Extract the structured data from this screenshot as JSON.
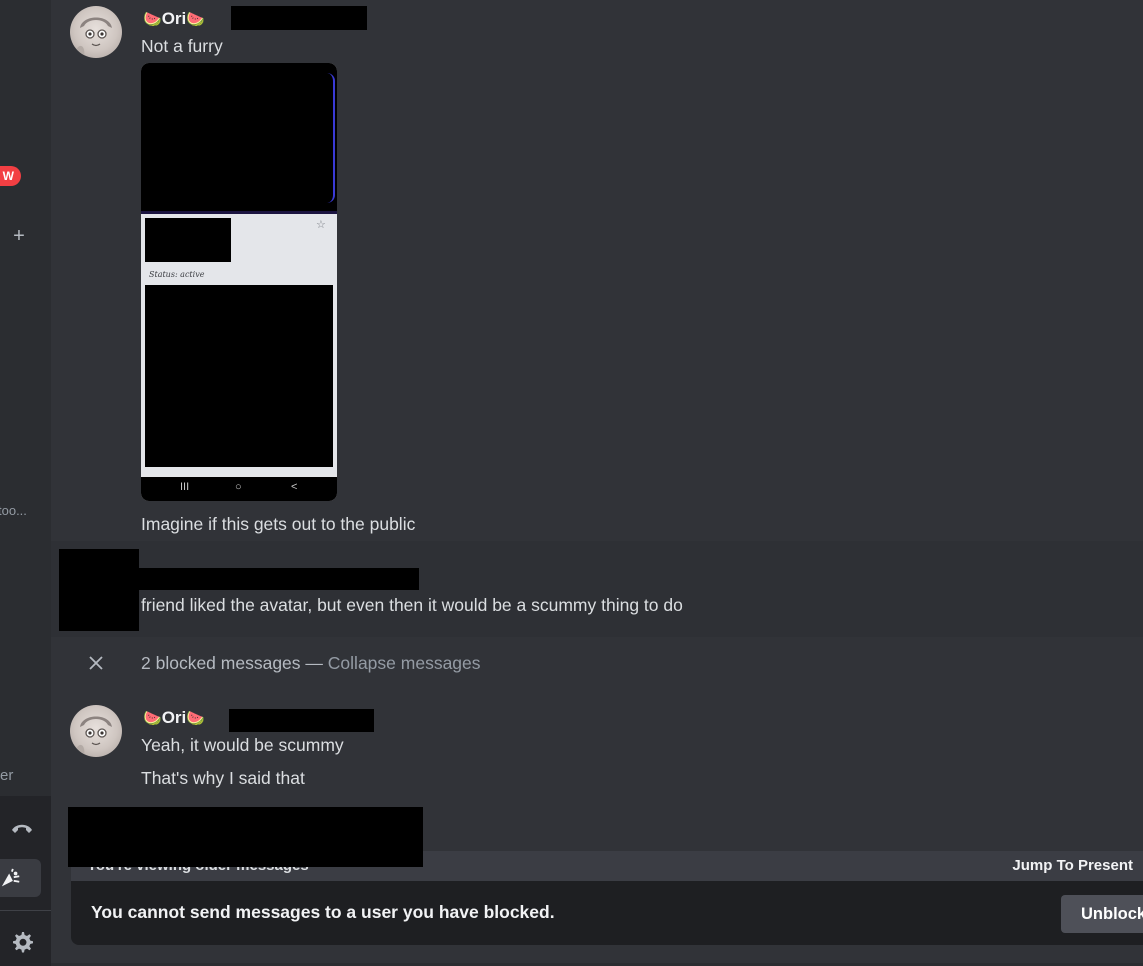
{
  "sidebar": {
    "badge_text": "W",
    "add_glyph": "+",
    "truncated_name": "too...",
    "truncated_label": "er",
    "icons": [
      "phone-hangup-icon",
      "soundboard-icon",
      "gear-icon"
    ]
  },
  "messages": [
    {
      "author_name": "Ori",
      "author_emoji": "🍉",
      "lines": [
        "Not a furry"
      ],
      "attachment": {
        "status_text": "Status: active",
        "star_glyph": "☆",
        "nav_buttons": [
          "III",
          "○",
          "<"
        ]
      },
      "after_text": "Imagine if this gets out to the public"
    },
    {
      "author_name": "",
      "lines": [
        "friend liked the avatar, but even then it would be a scummy thing to do"
      ]
    },
    {
      "author_name": "Ori",
      "author_emoji": "🍉",
      "lines": [
        "Yeah, it would be scummy",
        "That's why I said that"
      ]
    }
  ],
  "blocked": {
    "count_text": "2 blocked messages",
    "separator": "—",
    "collapse_label": "Collapse messages"
  },
  "composer": {
    "older_text": "You're viewing older messages",
    "jump_label": "Jump To Present",
    "blocked_notice": "You cannot send messages to a user you have blocked.",
    "unblock_label": "Unblock"
  },
  "colors": {
    "background": "#313338",
    "sidebar": "#2b2d31",
    "badge": "#f23f43",
    "notice_bg": "#1e1f22",
    "button_bg": "#4e5058"
  }
}
